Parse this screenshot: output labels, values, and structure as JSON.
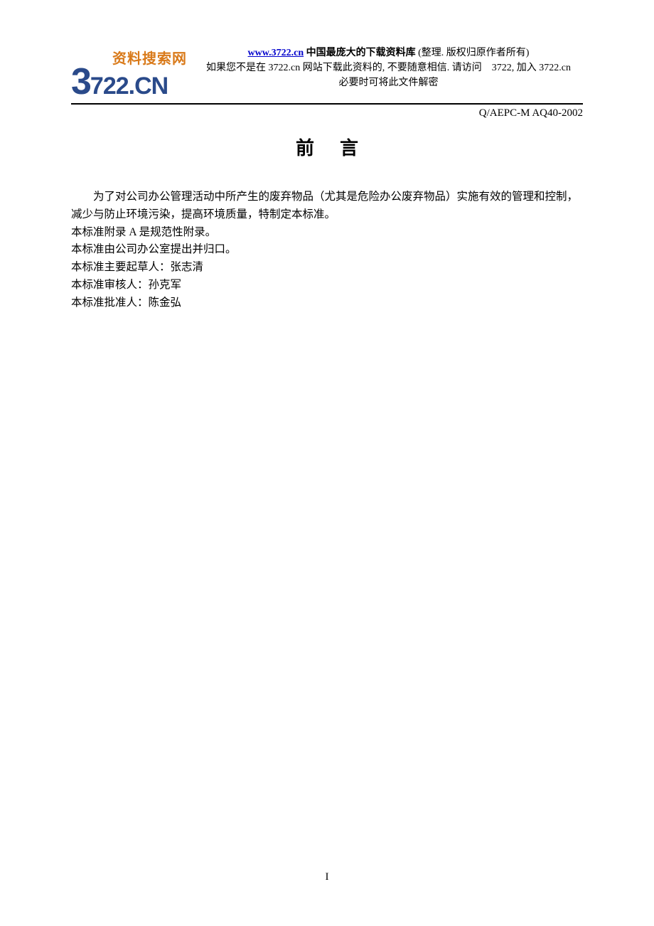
{
  "header": {
    "logo_top": "资料搜索网",
    "logo_3": "3",
    "logo_722cn": "722.CN",
    "link_text": "www.3722.cn",
    "line1_after_link": " 中国最庞大的下载资料库 ",
    "line1_paren": "(整理. 版权归原作者所有)",
    "line2": "如果您不是在 3722.cn 网站下载此资料的, 不要随意相信. 请访问　3722, 加入 3722.cn",
    "line3": "必要时可将此文件解密"
  },
  "doc_code": "Q/AEPC-M  AQ40-2002",
  "title": "前言",
  "body": {
    "p1": "为了对公司办公管理活动中所产生的废弃物品（尤其是危险办公废弃物品）实施有效的管理和控制，减少与防止环境污染，提高环境质量，特制定本标准。",
    "p2": "本标准附录 A 是规范性附录。",
    "p3": "本标准由公司办公室提出并归口。",
    "p4": "本标准主要起草人：张志清",
    "p5": "本标准审核人：孙克军",
    "p6": "本标准批准人：陈金弘"
  },
  "page_number": "I"
}
